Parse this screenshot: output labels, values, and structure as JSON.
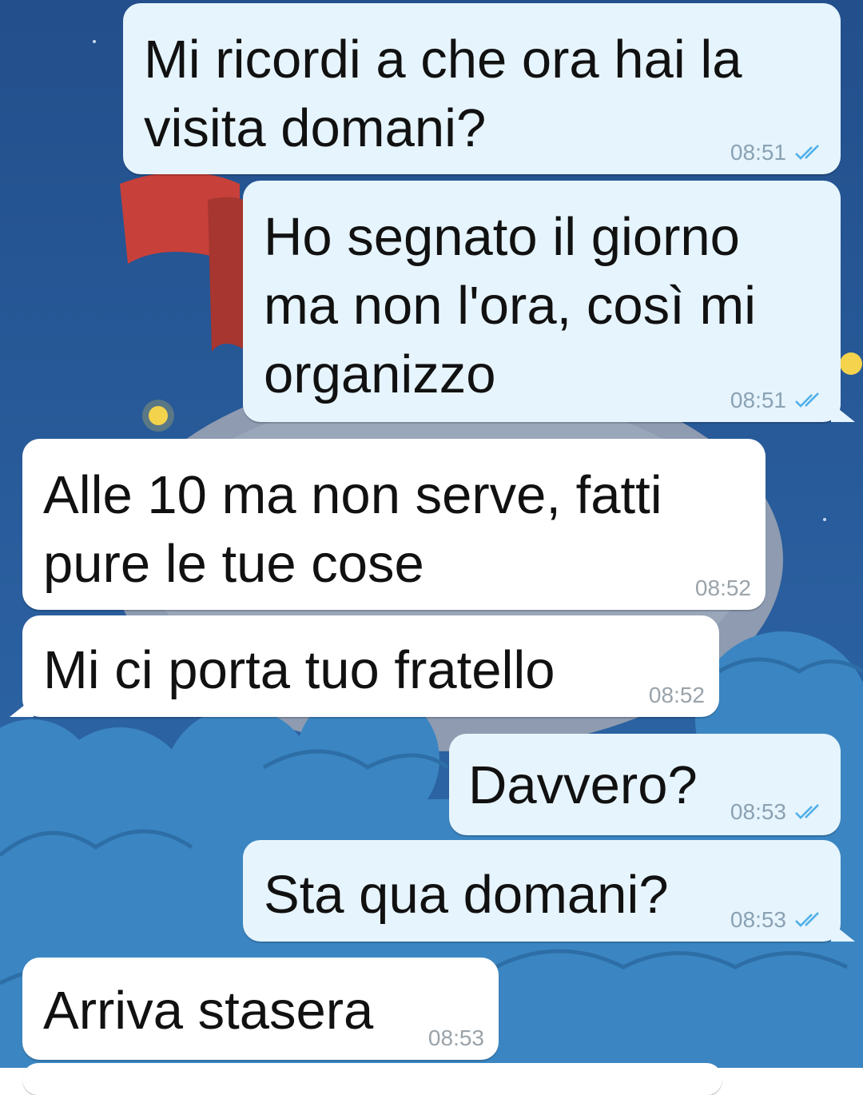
{
  "messages": [
    {
      "text": "Mi ricordi a che ora hai la\nvisita domani?",
      "time": "08:51",
      "direction": "outgoing",
      "read": true
    },
    {
      "text": "Ho segnato il giorno\nma non l'ora, così mi\norganizzo",
      "time": "08:51",
      "direction": "outgoing",
      "read": true
    },
    {
      "text": "Alle 10 ma non serve, fatti\npure le tue cose",
      "time": "08:52",
      "direction": "incoming"
    },
    {
      "text": "Mi ci porta tuo fratello",
      "time": "08:52",
      "direction": "incoming"
    },
    {
      "text": "Davvero?",
      "time": "08:53",
      "direction": "outgoing",
      "read": true
    },
    {
      "text": "Sta qua domani?",
      "time": "08:53",
      "direction": "outgoing",
      "read": true
    },
    {
      "text": "Arriva stasera",
      "time": "08:53",
      "direction": "incoming"
    }
  ],
  "colors": {
    "outgoing_bubble": "#e6f4fd",
    "incoming_bubble": "#ffffff",
    "read_ticks": "#4fb0e8",
    "background_sky": "#285a98",
    "clouds": "#3d8ec8"
  },
  "icons": {
    "read_receipt": "double-check-icon"
  }
}
